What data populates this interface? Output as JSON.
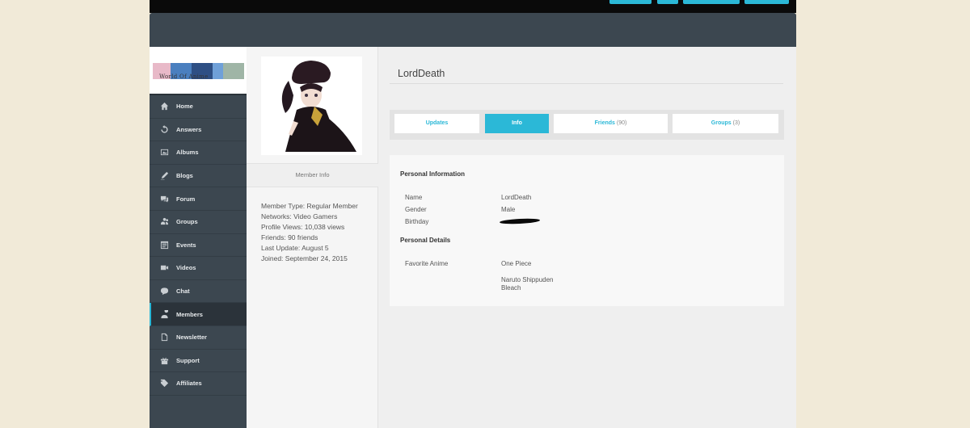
{
  "sidebar": {
    "items": [
      {
        "label": "Home",
        "icon": "home-icon"
      },
      {
        "label": "Answers",
        "icon": "refresh-icon"
      },
      {
        "label": "Albums",
        "icon": "image-icon"
      },
      {
        "label": "Blogs",
        "icon": "pen-icon"
      },
      {
        "label": "Forum",
        "icon": "speech-bubbles-icon"
      },
      {
        "label": "Groups",
        "icon": "users-icon"
      },
      {
        "label": "Events",
        "icon": "calendar-list-icon"
      },
      {
        "label": "Videos",
        "icon": "video-camera-icon"
      },
      {
        "label": "Chat",
        "icon": "chat-bubble-icon"
      },
      {
        "label": "Members",
        "icon": "member-icon"
      },
      {
        "label": "Newsletter",
        "icon": "document-icon"
      },
      {
        "label": "Support",
        "icon": "gift-icon"
      },
      {
        "label": "Affiliates",
        "icon": "tag-icon"
      }
    ],
    "active": "Members"
  },
  "member_info": {
    "header": "Member Info",
    "lines": [
      "Member Type: Regular Member",
      "Networks: Video Gamers",
      "Profile Views: 10,038 views",
      "Friends: 90 friends",
      "Last Update: August 5",
      "Joined: September 24, 2015"
    ]
  },
  "profile": {
    "username": "LordDeath"
  },
  "tabs": [
    {
      "label": "Updates",
      "count": ""
    },
    {
      "label": "Info",
      "count": ""
    },
    {
      "label": "Friends",
      "count": "(90)"
    },
    {
      "label": "Groups",
      "count": "(3)"
    }
  ],
  "info": {
    "personal_information": "Personal Information",
    "name_label": "Name",
    "name_value": "LordDeath",
    "gender_label": "Gender",
    "gender_value": "Male",
    "birthday_label": "Birthday",
    "personal_details": "Personal Details",
    "favorite_anime_label": "Favorite Anime",
    "favorite_anime_values": [
      "One Piece",
      "Naruto Shippuden",
      "Bleach"
    ]
  },
  "colors": {
    "accent": "#2bb8d7",
    "sidebar_bg": "#3c4750",
    "page_bg": "#f1ead8"
  }
}
